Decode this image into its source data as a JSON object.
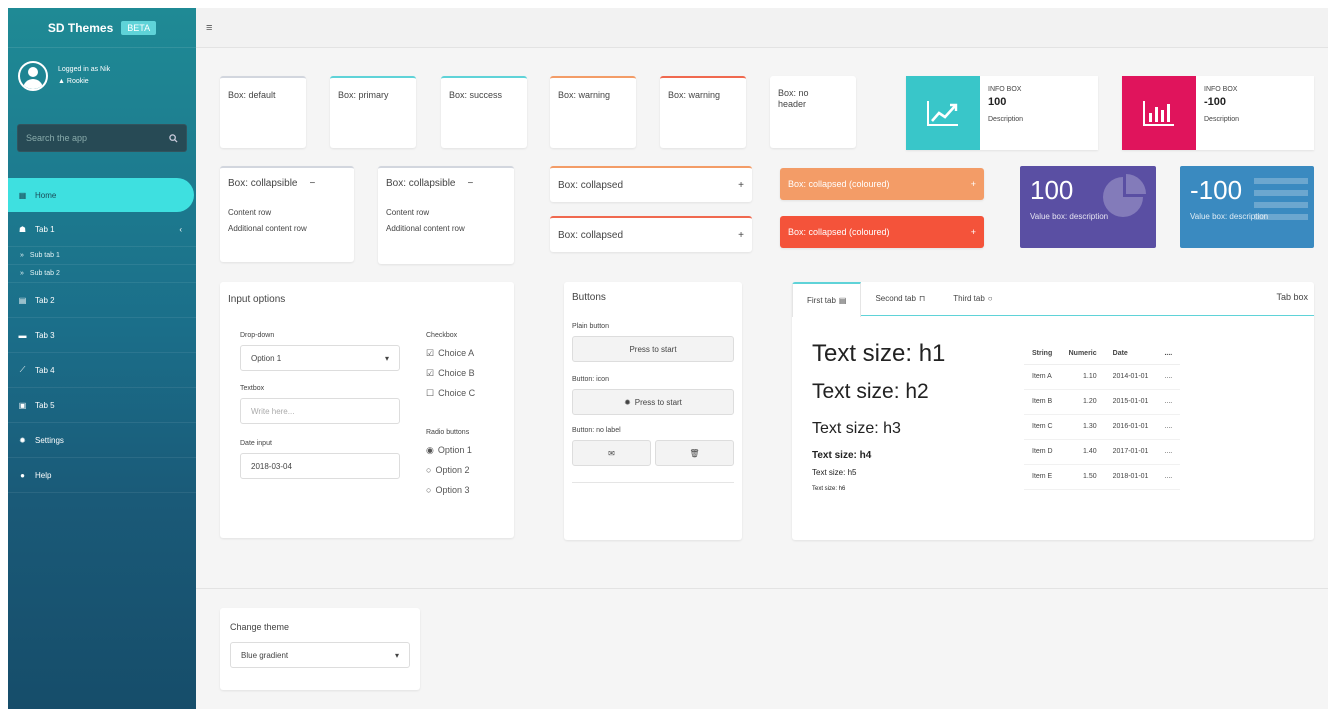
{
  "sidebar": {
    "brand": "SD Themes",
    "beta": "BETA",
    "user_line1": "Logged in as Nik",
    "user_line2": "Rookie",
    "search_placeholder": "Search the app",
    "items": [
      {
        "label": "Home",
        "icon": "table-icon"
      },
      {
        "label": "Tab 1",
        "icon": "users-icon"
      },
      {
        "label": "Sub tab 1",
        "icon": "chevron-right-icon"
      },
      {
        "label": "Sub tab 2",
        "icon": "chevron-right-icon"
      },
      {
        "label": "Tab 2",
        "icon": "file-icon"
      },
      {
        "label": "Tab 3",
        "icon": "list-icon"
      },
      {
        "label": "Tab 4",
        "icon": "chart-line-icon"
      },
      {
        "label": "Tab 5",
        "icon": "calendar-icon"
      },
      {
        "label": "Settings",
        "icon": "gear-icon"
      },
      {
        "label": "Help",
        "icon": "info-icon"
      }
    ]
  },
  "topbar": {
    "menu_icon": "hamburger-icon"
  },
  "boxes": {
    "default": "Box: default",
    "primary": "Box: primary",
    "success": "Box: success",
    "warning1": "Box: warning",
    "warning2": "Box: warning",
    "noheader_line1": "Box: no",
    "noheader_line2": "header"
  },
  "infoboxes": [
    {
      "title": "INFO BOX",
      "value": "100",
      "desc": "Description",
      "color": "#39c6c9"
    },
    {
      "title": "INFO BOX",
      "value": "-100",
      "desc": "Description",
      "color": "#e0145c"
    }
  ],
  "collapsible": [
    {
      "title": "Box: collapsible",
      "row1": "Content row",
      "row2": "Additional content row"
    },
    {
      "title": "Box: collapsible",
      "row1": "Content row",
      "row2": "Additional content row"
    }
  ],
  "collapsed": {
    "c1": "Box: collapsed",
    "c2": "Box: collapsed",
    "colored1": "Box: collapsed (coloured)",
    "colored2": "Box: collapsed (coloured)"
  },
  "valueboxes": [
    {
      "value": "100",
      "desc": "Value box: description",
      "color": "#5a4fa3"
    },
    {
      "value": "-100",
      "desc": "Value box: description",
      "color": "#3a8ac0"
    }
  ],
  "inputs": {
    "title": "Input options",
    "dropdown_label": "Drop-down",
    "dropdown_value": "Option 1",
    "textbox_label": "Textbox",
    "textbox_placeholder": "Write here...",
    "date_label": "Date input",
    "date_value": "2018-03-04",
    "checkbox_label": "Checkbox",
    "checkboxes": [
      {
        "label": "Choice A",
        "checked": true
      },
      {
        "label": "Choice B",
        "checked": true
      },
      {
        "label": "Choice C",
        "checked": false
      }
    ],
    "radio_label": "Radio buttons",
    "radios": [
      {
        "label": "Option 1",
        "checked": true
      },
      {
        "label": "Option 2",
        "checked": false
      },
      {
        "label": "Option 3",
        "checked": false
      }
    ]
  },
  "buttons": {
    "title": "Buttons",
    "plain_label": "Plain button",
    "plain_text": "Press to start",
    "icon_label": "Button: icon",
    "icon_text": "Press to start",
    "nolabel_label": "Button: no label"
  },
  "tabbox": {
    "tabs": [
      "First tab",
      "Second tab",
      "Third tab"
    ],
    "box_title": "Tab box",
    "headings": [
      "Text size: h1",
      "Text size: h2",
      "Text size: h3",
      "Text size: h4",
      "Text size: h5",
      "Text size: h6"
    ],
    "table": {
      "columns": [
        "String",
        "Numeric",
        "Date",
        "...."
      ],
      "rows": [
        [
          "Item A",
          "1.10",
          "2014-01-01",
          "...."
        ],
        [
          "Item B",
          "1.20",
          "2015-01-01",
          "...."
        ],
        [
          "Item C",
          "1.30",
          "2016-01-01",
          "...."
        ],
        [
          "Item D",
          "1.40",
          "2017-01-01",
          "...."
        ],
        [
          "Item E",
          "1.50",
          "2018-01-01",
          "...."
        ]
      ]
    }
  },
  "theme": {
    "label": "Change theme",
    "value": "Blue gradient"
  }
}
